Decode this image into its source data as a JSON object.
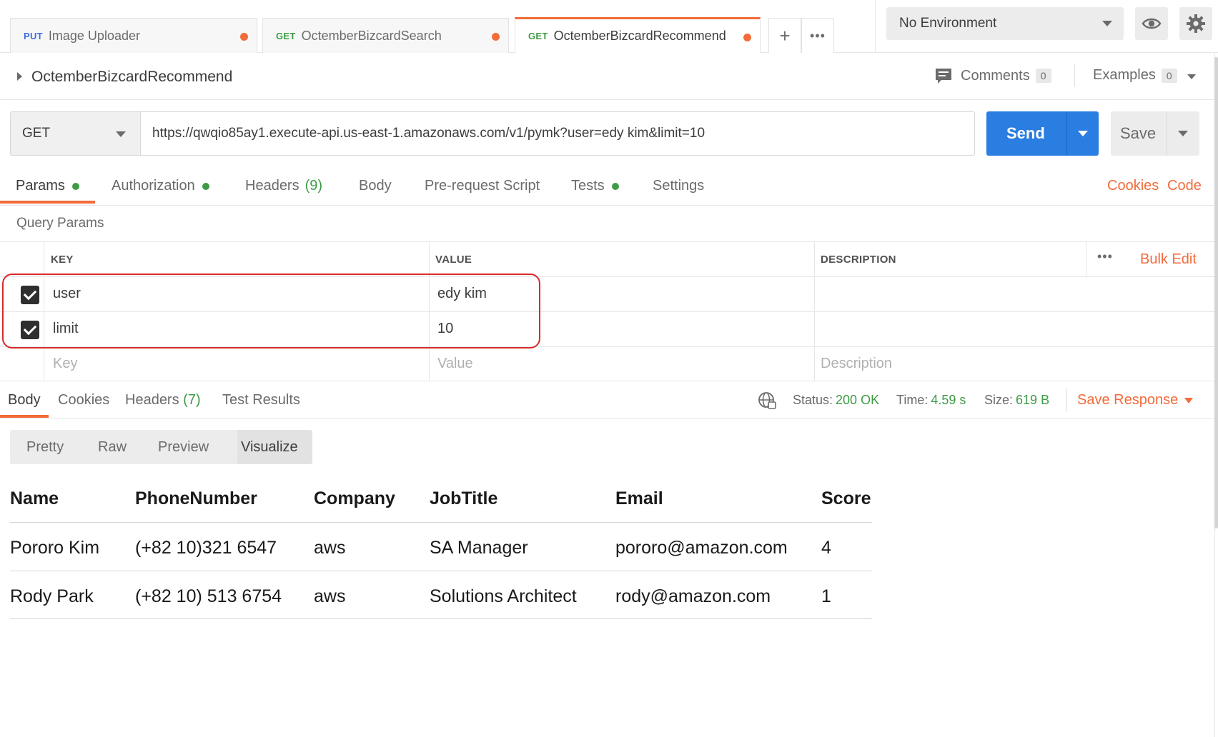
{
  "tabs": [
    {
      "method": "PUT",
      "name": "Image Uploader"
    },
    {
      "method": "GET",
      "name": "OctemberBizcardSearch"
    },
    {
      "method": "GET",
      "name": "OctemberBizcardRecommend"
    }
  ],
  "tab_actions": {
    "add": "+",
    "more": "•••"
  },
  "environment": {
    "selected": "No Environment"
  },
  "request": {
    "name": "OctemberBizcardRecommend",
    "comments_label": "Comments",
    "comments_count": "0",
    "examples_label": "Examples",
    "examples_count": "0",
    "method": "GET",
    "url": "https://qwqio85ay1.execute-api.us-east-1.amazonaws.com/v1/pymk?user=edy kim&limit=10",
    "send_label": "Send",
    "save_label": "Save"
  },
  "request_tabs": {
    "params": "Params",
    "authorization": "Authorization",
    "headers": "Headers",
    "headers_count": "(9)",
    "body": "Body",
    "prerequest": "Pre-request Script",
    "tests": "Tests",
    "settings": "Settings",
    "cookies_link": "Cookies",
    "code_link": "Code"
  },
  "query_params": {
    "section_label": "Query Params",
    "headers": {
      "key": "KEY",
      "value": "VALUE",
      "description": "DESCRIPTION"
    },
    "more": "•••",
    "bulk_edit": "Bulk Edit",
    "rows": [
      {
        "key": "user",
        "value": "edy kim",
        "checked": true
      },
      {
        "key": "limit",
        "value": "10",
        "checked": true
      }
    ],
    "placeholder": {
      "key": "Key",
      "value": "Value",
      "description": "Description"
    }
  },
  "response": {
    "tabs": {
      "body": "Body",
      "cookies": "Cookies",
      "headers": "Headers",
      "headers_count": "(7)",
      "test_results": "Test Results"
    },
    "status_label": "Status:",
    "status_value": "200 OK",
    "time_label": "Time:",
    "time_value": "4.59 s",
    "size_label": "Size:",
    "size_value": "619 B",
    "save_response": "Save Response",
    "view_modes": [
      "Pretty",
      "Raw",
      "Preview",
      "Visualize"
    ],
    "active_view": "Visualize"
  },
  "visualize_table": {
    "columns": [
      "Name",
      "PhoneNumber",
      "Company",
      "JobTitle",
      "Email",
      "Score"
    ],
    "rows": [
      [
        "Pororo Kim",
        "(+82 10)321 6547",
        "aws",
        "SA Manager",
        "pororo@amazon.com",
        "4"
      ],
      [
        "Rody Park",
        "(+82 10) 513 6754",
        "aws",
        "Solutions Architect",
        "rody@amazon.com",
        "1"
      ]
    ]
  },
  "colors": {
    "accent": "#f26b3a",
    "send": "#2a7de1",
    "ok": "#3e9b45",
    "highlight": "#d92b2b"
  }
}
